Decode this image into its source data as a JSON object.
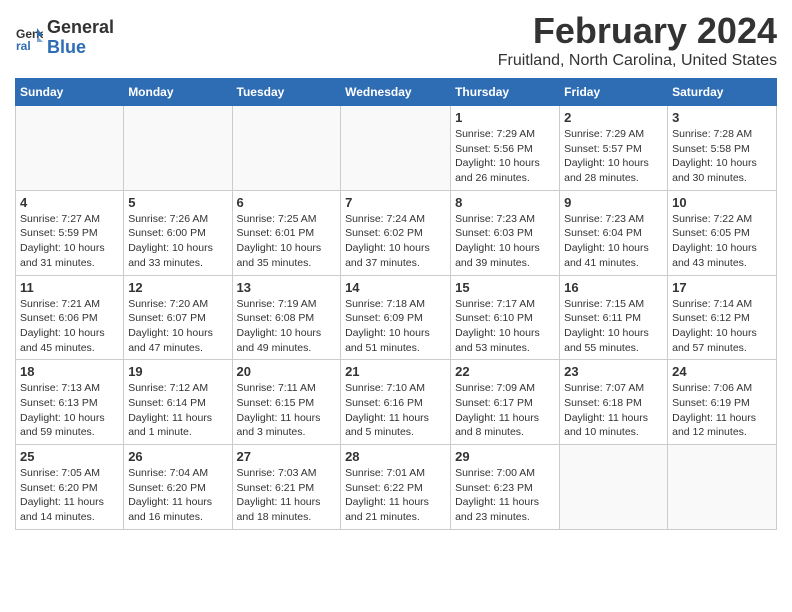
{
  "logo": {
    "line1": "General",
    "line2": "Blue"
  },
  "title": "February 2024",
  "subtitle": "Fruitland, North Carolina, United States",
  "weekdays": [
    "Sunday",
    "Monday",
    "Tuesday",
    "Wednesday",
    "Thursday",
    "Friday",
    "Saturday"
  ],
  "weeks": [
    [
      {
        "day": "",
        "info": ""
      },
      {
        "day": "",
        "info": ""
      },
      {
        "day": "",
        "info": ""
      },
      {
        "day": "",
        "info": ""
      },
      {
        "day": "1",
        "info": "Sunrise: 7:29 AM\nSunset: 5:56 PM\nDaylight: 10 hours\nand 26 minutes."
      },
      {
        "day": "2",
        "info": "Sunrise: 7:29 AM\nSunset: 5:57 PM\nDaylight: 10 hours\nand 28 minutes."
      },
      {
        "day": "3",
        "info": "Sunrise: 7:28 AM\nSunset: 5:58 PM\nDaylight: 10 hours\nand 30 minutes."
      }
    ],
    [
      {
        "day": "4",
        "info": "Sunrise: 7:27 AM\nSunset: 5:59 PM\nDaylight: 10 hours\nand 31 minutes."
      },
      {
        "day": "5",
        "info": "Sunrise: 7:26 AM\nSunset: 6:00 PM\nDaylight: 10 hours\nand 33 minutes."
      },
      {
        "day": "6",
        "info": "Sunrise: 7:25 AM\nSunset: 6:01 PM\nDaylight: 10 hours\nand 35 minutes."
      },
      {
        "day": "7",
        "info": "Sunrise: 7:24 AM\nSunset: 6:02 PM\nDaylight: 10 hours\nand 37 minutes."
      },
      {
        "day": "8",
        "info": "Sunrise: 7:23 AM\nSunset: 6:03 PM\nDaylight: 10 hours\nand 39 minutes."
      },
      {
        "day": "9",
        "info": "Sunrise: 7:23 AM\nSunset: 6:04 PM\nDaylight: 10 hours\nand 41 minutes."
      },
      {
        "day": "10",
        "info": "Sunrise: 7:22 AM\nSunset: 6:05 PM\nDaylight: 10 hours\nand 43 minutes."
      }
    ],
    [
      {
        "day": "11",
        "info": "Sunrise: 7:21 AM\nSunset: 6:06 PM\nDaylight: 10 hours\nand 45 minutes."
      },
      {
        "day": "12",
        "info": "Sunrise: 7:20 AM\nSunset: 6:07 PM\nDaylight: 10 hours\nand 47 minutes."
      },
      {
        "day": "13",
        "info": "Sunrise: 7:19 AM\nSunset: 6:08 PM\nDaylight: 10 hours\nand 49 minutes."
      },
      {
        "day": "14",
        "info": "Sunrise: 7:18 AM\nSunset: 6:09 PM\nDaylight: 10 hours\nand 51 minutes."
      },
      {
        "day": "15",
        "info": "Sunrise: 7:17 AM\nSunset: 6:10 PM\nDaylight: 10 hours\nand 53 minutes."
      },
      {
        "day": "16",
        "info": "Sunrise: 7:15 AM\nSunset: 6:11 PM\nDaylight: 10 hours\nand 55 minutes."
      },
      {
        "day": "17",
        "info": "Sunrise: 7:14 AM\nSunset: 6:12 PM\nDaylight: 10 hours\nand 57 minutes."
      }
    ],
    [
      {
        "day": "18",
        "info": "Sunrise: 7:13 AM\nSunset: 6:13 PM\nDaylight: 10 hours\nand 59 minutes."
      },
      {
        "day": "19",
        "info": "Sunrise: 7:12 AM\nSunset: 6:14 PM\nDaylight: 11 hours\nand 1 minute."
      },
      {
        "day": "20",
        "info": "Sunrise: 7:11 AM\nSunset: 6:15 PM\nDaylight: 11 hours\nand 3 minutes."
      },
      {
        "day": "21",
        "info": "Sunrise: 7:10 AM\nSunset: 6:16 PM\nDaylight: 11 hours\nand 5 minutes."
      },
      {
        "day": "22",
        "info": "Sunrise: 7:09 AM\nSunset: 6:17 PM\nDaylight: 11 hours\nand 8 minutes."
      },
      {
        "day": "23",
        "info": "Sunrise: 7:07 AM\nSunset: 6:18 PM\nDaylight: 11 hours\nand 10 minutes."
      },
      {
        "day": "24",
        "info": "Sunrise: 7:06 AM\nSunset: 6:19 PM\nDaylight: 11 hours\nand 12 minutes."
      }
    ],
    [
      {
        "day": "25",
        "info": "Sunrise: 7:05 AM\nSunset: 6:20 PM\nDaylight: 11 hours\nand 14 minutes."
      },
      {
        "day": "26",
        "info": "Sunrise: 7:04 AM\nSunset: 6:20 PM\nDaylight: 11 hours\nand 16 minutes."
      },
      {
        "day": "27",
        "info": "Sunrise: 7:03 AM\nSunset: 6:21 PM\nDaylight: 11 hours\nand 18 minutes."
      },
      {
        "day": "28",
        "info": "Sunrise: 7:01 AM\nSunset: 6:22 PM\nDaylight: 11 hours\nand 21 minutes."
      },
      {
        "day": "29",
        "info": "Sunrise: 7:00 AM\nSunset: 6:23 PM\nDaylight: 11 hours\nand 23 minutes."
      },
      {
        "day": "",
        "info": ""
      },
      {
        "day": "",
        "info": ""
      }
    ]
  ]
}
